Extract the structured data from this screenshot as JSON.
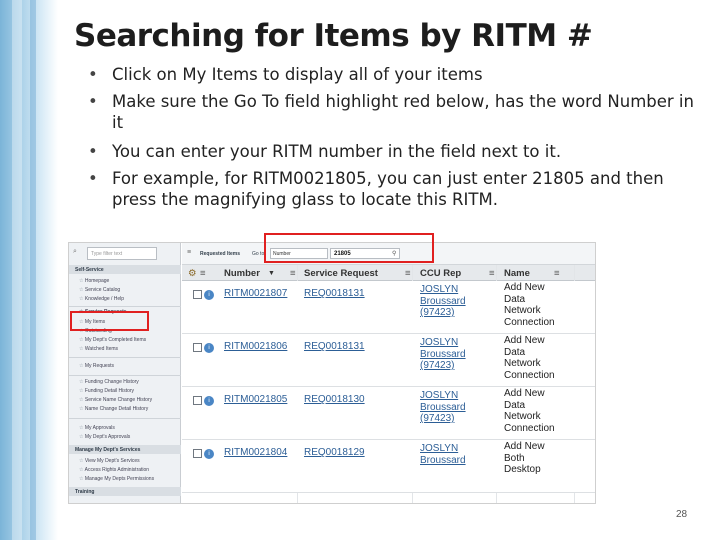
{
  "slide": {
    "title": "Searching for Items by RITM #",
    "bullets": [
      "Click on My Items to display all of your items",
      "Make sure the Go To field highlight red below, has the word Number in it",
      "You can enter your RITM number in the field next to it.",
      "For example, for RITM0021805, you can just enter 21805 and then press the magnifying glass to locate this RITM."
    ],
    "page_number": "28"
  },
  "colors": {
    "highlight": "#e02020",
    "link": "#2c5e96",
    "band": "#7bb4d8"
  },
  "nav": {
    "filter_placeholder": "Type filter text",
    "sections": {
      "self_service": "Self-Service",
      "manage": "Manage My Dept's Services",
      "training": "Training"
    },
    "items": {
      "homepage": "Homepage",
      "service_catalog": "Service Catalog",
      "knowledge": "Knowledge / Help",
      "service_requests": "Service Requests",
      "my_items": "My Items",
      "outstanding": "Outstanding",
      "completed": "My Dept's Completed Items",
      "watched": "Watched Items",
      "my_requests": "My Requests",
      "funding_change": "Funding Change History",
      "funding_detail": "Funding Detail History",
      "name_change": "Service Name Change History",
      "name_detail": "Name Change Detail History",
      "my_approvals": "My Approvals",
      "dept_approvals": "My Dept's Approvals",
      "view_services": "View My Dept's Services",
      "access_rights": "Access Rights Administration",
      "dept_permissions": "Manage My Depts Permissions"
    }
  },
  "toolbar": {
    "back_icon": "back-arrow-icon",
    "title": "Requested Items",
    "goto_label": "Go to",
    "goto_value": "Number",
    "search_value": "21805",
    "search_icon": "magnifier-icon"
  },
  "table": {
    "headers": [
      "Number",
      "Service Request",
      "CCU Rep",
      "Name"
    ],
    "sort_icon": "▼",
    "menu_icon": "≡",
    "rows": [
      {
        "number": "RITM0021807",
        "request": "REQ0018131",
        "rep": [
          "JOSLYN",
          "Broussard",
          "(97423)"
        ],
        "name": [
          "Add New",
          "Data",
          "Network",
          "Connection"
        ]
      },
      {
        "number": "RITM0021806",
        "request": "REQ0018131",
        "rep": [
          "JOSLYN",
          "Broussard",
          "(97423)"
        ],
        "name": [
          "Add New",
          "Data",
          "Network",
          "Connection"
        ]
      },
      {
        "number": "RITM0021805",
        "request": "REQ0018130",
        "rep": [
          "JOSLYN",
          "Broussard",
          "(97423)"
        ],
        "name": [
          "Add New",
          "Data",
          "Network",
          "Connection"
        ]
      },
      {
        "number": "RITM0021804",
        "request": "REQ0018129",
        "rep": [
          "JOSLYN",
          "Broussard"
        ],
        "name": [
          "Add New",
          "Both",
          "Desktop"
        ]
      }
    ]
  }
}
